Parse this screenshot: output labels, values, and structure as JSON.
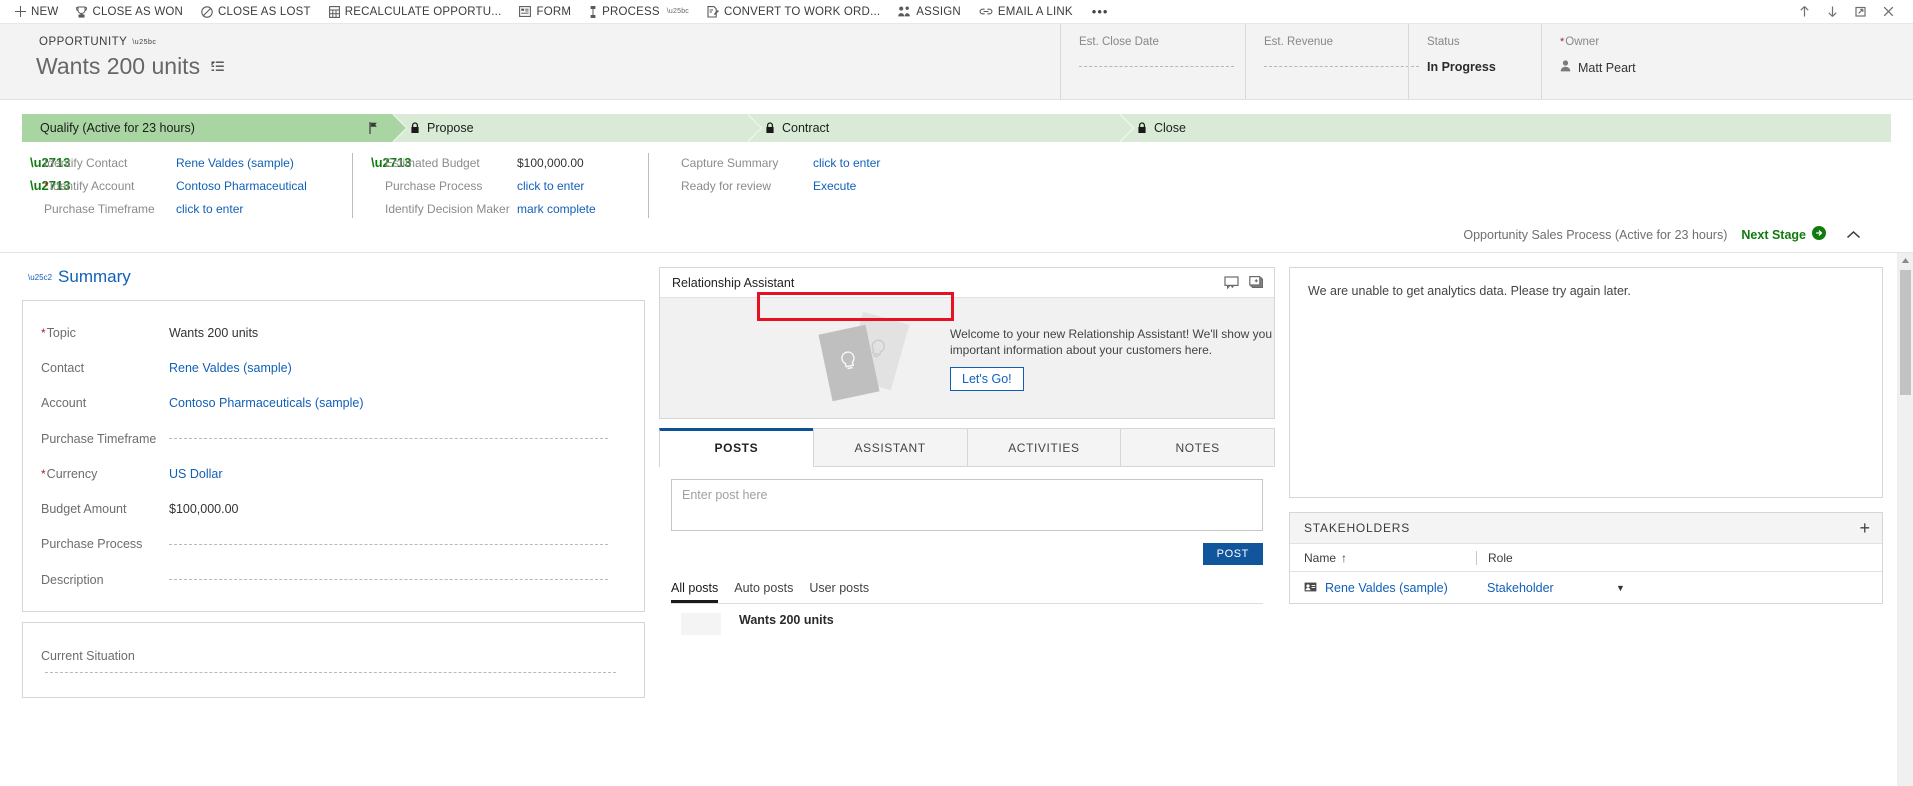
{
  "commandbar": {
    "items": [
      {
        "label": "NEW",
        "icon": "plus-icon",
        "caret": false
      },
      {
        "label": "CLOSE AS WON",
        "icon": "trophy-icon",
        "caret": false
      },
      {
        "label": "CLOSE AS LOST",
        "icon": "no-entry-icon",
        "caret": false
      },
      {
        "label": "RECALCULATE OPPORTU...",
        "icon": "calculator-icon",
        "caret": false
      },
      {
        "label": "FORM",
        "icon": "form-icon",
        "caret": false
      },
      {
        "label": "PROCESS",
        "icon": "process-icon",
        "caret": true
      },
      {
        "label": "CONVERT TO WORK ORD...",
        "icon": "convert-icon",
        "caret": false
      },
      {
        "label": "ASSIGN",
        "icon": "assign-users-icon",
        "caret": false
      },
      {
        "label": "EMAIL A LINK",
        "icon": "link-icon",
        "caret": false
      }
    ],
    "overflow_label": "•••",
    "window_controls": [
      "up-arrow-icon",
      "down-arrow-icon",
      "popout-icon",
      "close-icon"
    ]
  },
  "record_header": {
    "entity_type": "OPPORTUNITY",
    "title": "Wants 200 units",
    "fields": [
      {
        "label": "Est. Close Date",
        "value": "",
        "required": false,
        "empty": true,
        "style": "normal"
      },
      {
        "label": "Est. Revenue",
        "value": "",
        "required": false,
        "empty": true,
        "style": "normal"
      },
      {
        "label": "Status",
        "value": "In Progress",
        "required": false,
        "empty": false,
        "style": "bold"
      },
      {
        "label": "Owner",
        "value": "Matt Peart",
        "required": true,
        "empty": false,
        "style": "link"
      }
    ]
  },
  "process": {
    "stages": [
      {
        "label": "Qualify (Active for 23 hours)",
        "active": true,
        "locked": false
      },
      {
        "label": "Propose",
        "active": false,
        "locked": true
      },
      {
        "label": "Contract",
        "active": false,
        "locked": true
      },
      {
        "label": "Close",
        "active": false,
        "locked": true
      }
    ],
    "columns": [
      {
        "steps": [
          {
            "label": "Identify Contact",
            "value": "Rene Valdes (sample)",
            "checked": true,
            "required": false,
            "link": true
          },
          {
            "label": "Identify Account",
            "value": "Contoso Pharmaceutical",
            "checked": true,
            "required": true,
            "link": true
          },
          {
            "label": "Purchase Timeframe",
            "value": "click to enter",
            "checked": false,
            "required": false,
            "link": true
          }
        ]
      },
      {
        "steps": [
          {
            "label": "Estimated Budget",
            "value": "$100,000.00",
            "checked": true,
            "required": false,
            "link": false
          },
          {
            "label": "Purchase Process",
            "value": "click to enter",
            "checked": false,
            "required": false,
            "link": true
          },
          {
            "label": "Identify Decision Maker",
            "value": "mark complete",
            "checked": false,
            "required": false,
            "link": true
          }
        ]
      },
      {
        "steps": [
          {
            "label": "Capture Summary",
            "value": "click to enter",
            "checked": false,
            "required": false,
            "link": true
          },
          {
            "label": "Ready for review",
            "value": "Execute",
            "checked": false,
            "required": false,
            "link": true
          }
        ]
      }
    ],
    "footer_name": "Opportunity Sales Process (Active for 23 hours)",
    "next_stage_label": "Next Stage",
    "highlight_color": "#e81123"
  },
  "summary": {
    "section_title": "Summary",
    "fields": [
      {
        "label": "Topic",
        "value": "Wants 200 units",
        "required": true,
        "empty": false,
        "link": false
      },
      {
        "label": "Contact",
        "value": "Rene Valdes (sample)",
        "required": false,
        "empty": false,
        "link": true
      },
      {
        "label": "Account",
        "value": "Contoso Pharmaceuticals (sample)",
        "required": false,
        "empty": false,
        "link": true
      },
      {
        "label": "Purchase Timeframe",
        "value": "",
        "required": false,
        "empty": true,
        "link": false
      },
      {
        "label": "Currency",
        "value": "US Dollar",
        "required": true,
        "empty": false,
        "link": true
      },
      {
        "label": "Budget Amount",
        "value": "$100,000.00",
        "required": false,
        "empty": false,
        "link": false
      },
      {
        "label": "Purchase Process",
        "value": "",
        "required": false,
        "empty": true,
        "link": false
      },
      {
        "label": "Description",
        "value": "",
        "required": false,
        "empty": true,
        "link": false
      }
    ],
    "current_situation_label": "Current Situation"
  },
  "assistant": {
    "panel_title": "Relationship Assistant",
    "welcome_text": "Welcome to your new Relationship Assistant! We'll show you important information about your customers here.",
    "cta_label": "Let's Go!",
    "header_icons": [
      "feedback-icon",
      "cards-stack-icon"
    ]
  },
  "social": {
    "tabs": [
      {
        "label": "POSTS",
        "selected": true
      },
      {
        "label": "ASSISTANT",
        "selected": false
      },
      {
        "label": "ACTIVITIES",
        "selected": false
      },
      {
        "label": "NOTES",
        "selected": false
      }
    ],
    "post_placeholder": "Enter post here",
    "post_value": "",
    "post_button_label": "POST",
    "filters": [
      {
        "label": "All posts",
        "selected": true
      },
      {
        "label": "Auto posts",
        "selected": false
      },
      {
        "label": "User posts",
        "selected": false
      }
    ],
    "feed": [
      {
        "title": "Wants 200 units"
      }
    ]
  },
  "analytics": {
    "message": "We are unable to get analytics data. Please try again later."
  },
  "stakeholders": {
    "title": "STAKEHOLDERS",
    "add_label": "+",
    "columns": [
      "Name",
      "Role",
      ""
    ],
    "sort_indicator": "↑",
    "rows": [
      {
        "name": "Rene Valdes (sample)",
        "role": "Stakeholder",
        "menu": "▼"
      }
    ]
  }
}
